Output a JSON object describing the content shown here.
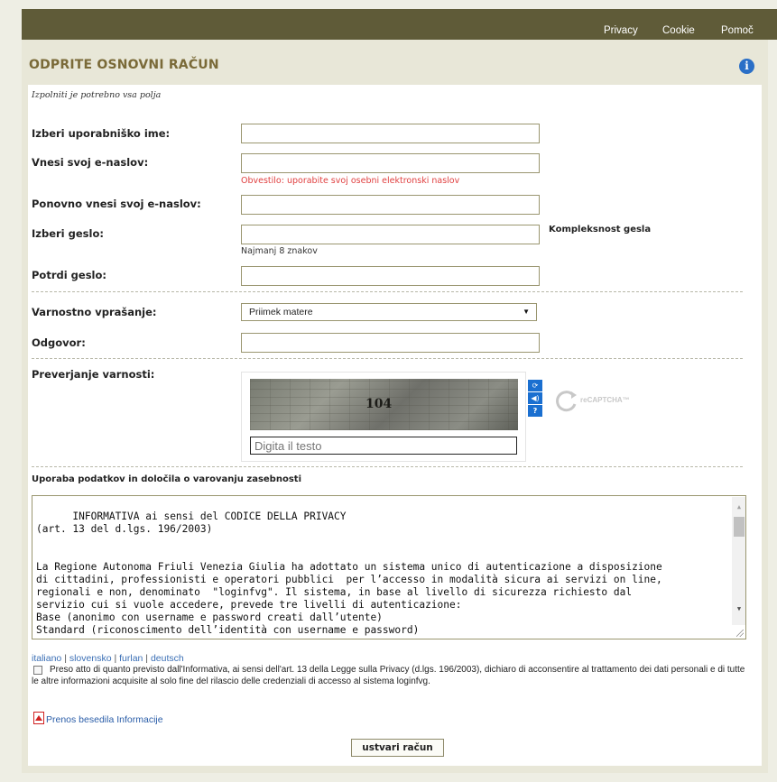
{
  "topbar": {
    "privacy": "Privacy",
    "cookie": "Cookie",
    "help": "Pomoč"
  },
  "page": {
    "title": "ODPRITE OSNOVNI RAČUN",
    "required_note": "Izpolniti je potrebno vsa polja"
  },
  "form": {
    "username_label": "Izberi uporabniško ime:",
    "email_label": "Vnesi svoj e-naslov:",
    "email_warning": "Obvestilo: uporabite svoj osebni elektronski naslov",
    "email_confirm_label": "Ponovno vnesi svoj e-naslov:",
    "password_label": "Izberi geslo:",
    "password_strength_label": "Kompleksnost gesla",
    "password_hint": "Najmanj 8 znakov",
    "password_confirm_label": "Potrdi geslo:",
    "security_question_label": "Varnostno vprašanje:",
    "security_question_value": "Priimek matere",
    "answer_label": "Odgovor:",
    "captcha_label": "Preverjanje varnosti:",
    "captcha_word": "104",
    "captcha_placeholder": "Digita il testo",
    "recaptcha_brand": "reCAPTCHA™"
  },
  "privacy": {
    "heading": "Uporaba podatkov in določila o varovanju zasebnosti",
    "text": "INFORMATIVA ai sensi del CODICE DELLA PRIVACY\n(art. 13 del d.lgs. 196/2003)\n\n\nLa Regione Autonoma Friuli Venezia Giulia ha adottato un sistema unico di autenticazione a disposizione\ndi cittadini, professionisti e operatori pubblici  per l’accesso in modalità sicura ai servizi on line,\nregionali e non, denominato  \"loginfvg\". Il sistema, in base al livello di sicurezza richiesto dal\nservizio cui si vuole accedere, prevede tre livelli di autenticazione:\nBase (anonimo con username e password creati dall’utente)\nStandard (riconoscimento dell’identità con username e password)",
    "languages": [
      "italiano",
      "slovensko",
      "furlan",
      "deutsch"
    ],
    "consent": "Preso atto di quanto previsto dall'Informativa, ai sensi dell'art. 13 della Legge sulla Privacy (d.lgs. 196/2003), dichiaro di acconsentire al trattamento dei dati personali e di tutte le altre informazioni acquisite al solo fine del rilascio delle credenziali di accesso al sistema loginfvg.",
    "pdf_link": "Prenos besedila Informacije"
  },
  "actions": {
    "submit": "ustvari račun"
  },
  "colors": {
    "topbar": "#5f5b38",
    "title": "#7a6a38",
    "warning": "#e04040",
    "link": "#3b6fb5"
  },
  "icons": [
    "info-icon",
    "refresh-icon",
    "audio-icon",
    "help-icon",
    "pdf-icon",
    "chevron-down-icon"
  ]
}
